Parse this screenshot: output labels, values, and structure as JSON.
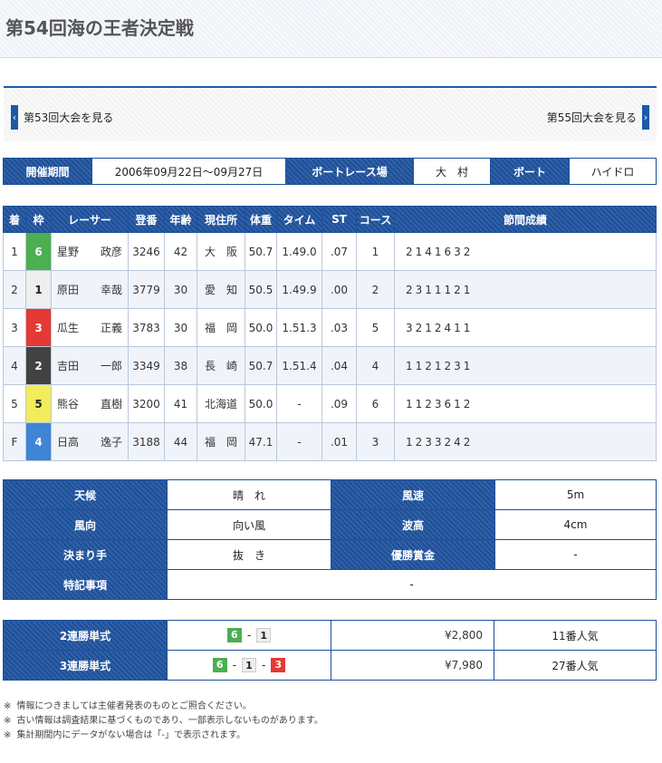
{
  "header": {
    "title": "第54回海の王者決定戦"
  },
  "nav": {
    "prev_label": "第53回大会を見る",
    "next_label": "第55回大会を見る",
    "prev_arrow": "‹",
    "next_arrow": "›"
  },
  "info": {
    "period_label": "開催期間",
    "period_value": "2006年09月22日〜09月27日",
    "venue_label": "ボートレース場",
    "venue_value": "大　村",
    "boat_label": "ボート",
    "boat_value": "ハイドロ"
  },
  "results": {
    "headers": [
      "着",
      "枠",
      "レーサー",
      "登番",
      "年齢",
      "現住所",
      "体重",
      "タイム",
      "ST",
      "コース",
      "節間成績"
    ],
    "rows": [
      {
        "rank": "1",
        "waku": "6",
        "name": "星野　　政彦",
        "id": "3246",
        "age": "42",
        "home": "大　阪",
        "weight": "50.7",
        "time": "1.49.0",
        "st": ".07",
        "course": "1",
        "sets": "2141632"
      },
      {
        "rank": "2",
        "waku": "1",
        "name": "原田　　幸哉",
        "id": "3779",
        "age": "30",
        "home": "愛　知",
        "weight": "50.5",
        "time": "1.49.9",
        "st": ".00",
        "course": "2",
        "sets": "2311121"
      },
      {
        "rank": "3",
        "waku": "3",
        "name": "瓜生　　正義",
        "id": "3783",
        "age": "30",
        "home": "福　岡",
        "weight": "50.0",
        "time": "1.51.3",
        "st": ".03",
        "course": "5",
        "sets": "3212411"
      },
      {
        "rank": "4",
        "waku": "2",
        "name": "吉田　　一郎",
        "id": "3349",
        "age": "38",
        "home": "長　崎",
        "weight": "50.7",
        "time": "1.51.4",
        "st": ".04",
        "course": "4",
        "sets": "1121231"
      },
      {
        "rank": "5",
        "waku": "5",
        "name": "熊谷　　直樹",
        "id": "3200",
        "age": "41",
        "home": "北海道",
        "weight": "50.0",
        "time": "-",
        "st": ".09",
        "course": "6",
        "sets": "1123612"
      },
      {
        "rank": "F",
        "waku": "4",
        "name": "日高　　逸子",
        "id": "3188",
        "age": "44",
        "home": "福　岡",
        "weight": "47.1",
        "time": "-",
        "st": ".01",
        "course": "3",
        "sets": "1233242"
      }
    ]
  },
  "weather": {
    "weather_label": "天候",
    "weather_value": "晴　れ",
    "wind_speed_label": "風速",
    "wind_speed_value": "5m",
    "wind_dir_label": "風向",
    "wind_dir_value": "向い風",
    "wave_label": "波高",
    "wave_value": "4cm",
    "kimarite_label": "決まり手",
    "kimarite_value": "抜　き",
    "prize_label": "優勝賞金",
    "prize_value": "-",
    "notes_label": "特記事項",
    "notes_value": "-"
  },
  "payout": {
    "rows": [
      {
        "label": "2連勝単式",
        "combo": [
          "6",
          "1"
        ],
        "amount": "¥2,800",
        "pop": "11番人気"
      },
      {
        "label": "3連勝単式",
        "combo": [
          "6",
          "1",
          "3"
        ],
        "amount": "¥7,980",
        "pop": "27番人気"
      }
    ],
    "separator": "-"
  },
  "footnotes": {
    "mark": "※",
    "items": [
      "情報につきましては主催者発表のものとご照合ください。",
      "古い情報は調査結果に基づくものであり、一部表示しないものがあります。",
      "集計期間内にデータがない場合は「-」で表示されます。"
    ]
  },
  "colors": {
    "accent": "#1c4f9a",
    "waku1": "#eeeeee",
    "waku2": "#424242",
    "waku3": "#e53935",
    "waku4": "#3f84d6",
    "waku5": "#f2ec5c",
    "waku6": "#4caf50"
  }
}
